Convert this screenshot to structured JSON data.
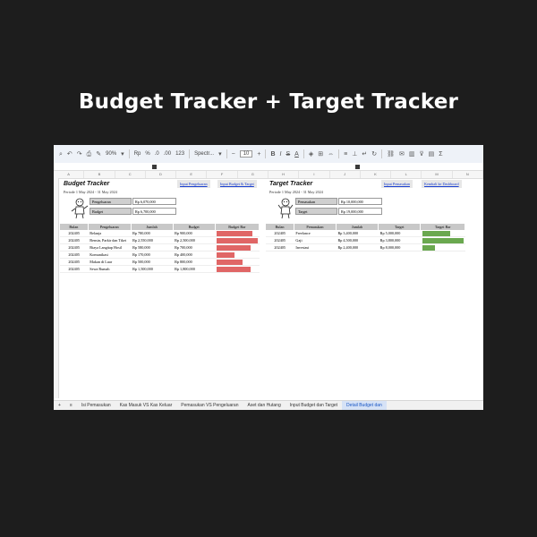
{
  "headline": "Budget Tracker + Target Tracker",
  "toolbar": {
    "zoom": "90%",
    "font": "Spectr...",
    "font_size": "10",
    "percent": "%",
    "decimals": ".0",
    "decimals_more": ".00",
    "number_format": "123"
  },
  "columns": [
    "A",
    "B",
    "C",
    "D",
    "E",
    "F",
    "G",
    "H",
    "I",
    "J",
    "K",
    "L",
    "M",
    "N"
  ],
  "budget": {
    "title": "Budget Tracker",
    "link_input": "Input Pengeluaran",
    "link_budget": "Input Budget & Target",
    "period": "Periode 1 May 2024 - 31 May 2024",
    "summary": [
      {
        "label": "Pengeluaran",
        "value": "Rp 6,070,000"
      },
      {
        "label": "Budget",
        "value": "Rp 6,700,000"
      }
    ],
    "headers": [
      "Bulan",
      "Pengeluaran",
      "Jumlah",
      "Budget",
      "Budget Bar"
    ],
    "rows": [
      {
        "month": "202405",
        "name": "Belanja",
        "amount": "Rp 780,000",
        "budget": "Rp 900,000",
        "ratio": 0.87
      },
      {
        "month": "202405",
        "name": "Bensin, Parkir dan Tiket",
        "amount": "Rp 2,550,000",
        "budget": "Rp 2,500,000",
        "ratio": 1.0
      },
      {
        "month": "202405",
        "name": "Biaya Langitap Hosil",
        "amount": "Rp 580,000",
        "budget": "Rp 700,000",
        "ratio": 0.83
      },
      {
        "month": "202405",
        "name": "Komunikasi",
        "amount": "Rp 170,000",
        "budget": "Rp 400,000",
        "ratio": 0.43
      },
      {
        "month": "202405",
        "name": "Makan di Luar",
        "amount": "Rp 500,000",
        "budget": "Rp 800,000",
        "ratio": 0.63
      },
      {
        "month": "202405",
        "name": "Sewa Rumah",
        "amount": "Rp 1,500,000",
        "budget": "Rp 1,800,000",
        "ratio": 0.83
      }
    ],
    "bar_color": "#e06666"
  },
  "target": {
    "title": "Target Tracker",
    "link_input": "Input Pemasukan",
    "link_dashboard": "Kembali ke Dashboard",
    "period": "Periode 1 May 2024 - 31 May 2024",
    "summary": [
      {
        "label": "Pemasukan",
        "value": "Rp 10,000,000"
      },
      {
        "label": "Target",
        "value": "Rp 19,000,000"
      }
    ],
    "headers": [
      "Bulan",
      "Pemasukan",
      "Jumlah",
      "Target",
      "Target Bar"
    ],
    "rows": [
      {
        "month": "202405",
        "name": "Freelance",
        "amount": "Rp 3,400,000",
        "target": "Rp 5,000,000",
        "ratio": 0.68
      },
      {
        "month": "202405",
        "name": "Gaji",
        "amount": "Rp 4,500,000",
        "target": "Rp 3,800,000",
        "ratio": 1.0
      },
      {
        "month": "202405",
        "name": "Investasi",
        "amount": "Rp 2,400,000",
        "target": "Rp 8,000,000",
        "ratio": 0.3
      }
    ],
    "bar_color": "#6aa84f"
  },
  "tabs": [
    {
      "label": "+",
      "active": false
    },
    {
      "label": "≡",
      "active": false
    },
    {
      "label": "Isi Pemasukan",
      "active": false
    },
    {
      "label": "Kas Masuk VS Kas Keluar",
      "active": false
    },
    {
      "label": "Pemasukan VS Pengeluaran",
      "active": false
    },
    {
      "label": "Aset dan Hutang",
      "active": false
    },
    {
      "label": "Input Budget dan Target",
      "active": false
    },
    {
      "label": "Detail Budget dan",
      "active": true
    }
  ],
  "icons": {
    "undo": "undo-icon",
    "redo": "redo-icon",
    "print": "print-icon",
    "paint_format": "paint-format-icon",
    "bold": "bold-icon",
    "italic": "italic-icon",
    "strikethrough": "strikethrough-icon",
    "text_color": "text-color-icon",
    "fill": "fill-color-icon",
    "borders": "borders-icon",
    "merge": "merge-icon",
    "align": "align-icon",
    "link": "link-icon",
    "comment": "comment-icon",
    "chart": "chart-icon",
    "filter": "filter-icon",
    "functions": "functions-icon"
  }
}
